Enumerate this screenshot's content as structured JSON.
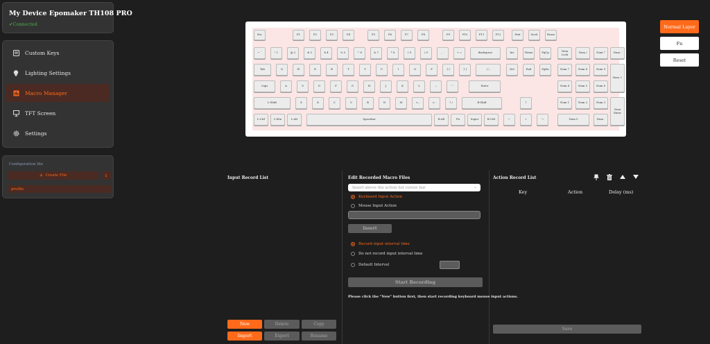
{
  "device": {
    "title": "My Device Epomaker TH108 PRO",
    "status": "Connected"
  },
  "nav": {
    "items": [
      {
        "label": "Custom Keys",
        "icon": "keyboard-icon"
      },
      {
        "label": "Lighting Settings",
        "icon": "lightbulb-icon"
      },
      {
        "label": "Macro Manager",
        "icon": "macro-icon",
        "active": true
      },
      {
        "label": "TFT Screen",
        "icon": "monitor-icon"
      },
      {
        "label": "Settings",
        "icon": "gear-icon"
      }
    ]
  },
  "config": {
    "title": "Configuration file",
    "create_label": "Create File",
    "profile_label": "profile"
  },
  "keyboard": {
    "keys": [
      "Esc",
      "F1",
      "F2",
      "F3",
      "F4",
      "F5",
      "F6",
      "F7",
      "F8",
      "F9",
      "F10",
      "F11",
      "F12",
      "Prnt",
      "Scrol",
      "Pause",
      "~ `",
      "! 1",
      "@ 2",
      "# 3",
      "$ 4",
      "% 5",
      "^ 6",
      "& 7",
      "* 8",
      "( 9",
      ") 0",
      "_ -",
      "+ =",
      "Backspace",
      "Ins",
      "Home",
      "PgUp",
      "Num Lock",
      "Num /",
      "Num *",
      "Num -",
      "Tab",
      "Q",
      "W",
      "E",
      "R",
      "T",
      "Y",
      "U",
      "I",
      "O",
      "P",
      "{ [",
      "} ]",
      "| \\",
      "Del",
      "End",
      "PgDn",
      "Num 7",
      "Num 8",
      "Num 9",
      "Num +",
      "Caps",
      "A",
      "S",
      "D",
      "F",
      "G",
      "H",
      "J",
      "K",
      "L",
      ": ;",
      "\" '",
      "Enter",
      "Num 4",
      "Num 5",
      "Num 6",
      "L-Shift",
      "Z",
      "X",
      "C",
      "V",
      "B",
      "N",
      "M",
      "< ,",
      "> .",
      "? /",
      "R-Shift",
      "↑",
      "Num 1",
      "Num 2",
      "Num 3",
      "Num Enter",
      "L-Ctrl",
      "L-Win",
      "L-Alt",
      "Spacebar",
      "R-Alt",
      "Fn",
      "Super",
      "R-Ctrl",
      "←",
      "↓",
      "→",
      "Num 0",
      "Num ."
    ]
  },
  "layers": [
    "Normal Layer",
    "Fn",
    "Reset"
  ],
  "input_record": {
    "title": "Input Record List",
    "buttons": [
      "New",
      "Delete",
      "Copy",
      "Import",
      "Export",
      "Rename"
    ]
  },
  "edit_macro": {
    "title": "Edit Recorded Macro Files",
    "insert_placeholder": "Insert above the action list cursor bar",
    "keyboard_action": "Keyboard Input Action",
    "mouse_action": "Mouse Input Action",
    "insert_label": "Insert",
    "record_interval": "Record input interval time",
    "no_record_interval": "Do not record input interval time",
    "default_interval": "Default Interval",
    "start_label": "Start Recording",
    "hint": "Please click the \"New\" button first, then start recording keyboard mouse input actions."
  },
  "action_record": {
    "title": "Action Record List",
    "columns": [
      "Key",
      "Action",
      "Delay (ms)"
    ],
    "save_label": "Save"
  }
}
